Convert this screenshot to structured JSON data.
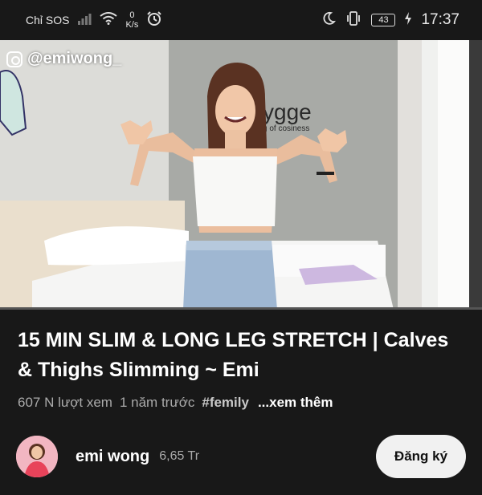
{
  "status_bar": {
    "carrier": "Chỉ SOS",
    "net_speed_value": "0",
    "net_speed_unit": "K/s",
    "battery": "43",
    "time": "17:37"
  },
  "video": {
    "watermark": "@emiwong_",
    "wall_sign": "ygge",
    "wall_sign_sub": "g of cosiness",
    "progress_percent": 0
  },
  "info": {
    "title": "15 MIN SLIM & LONG LEG STRETCH | Calves & Thighs Slimming ~ Emi",
    "views": "607 N lượt xem",
    "age": "1 năm trước",
    "hashtag": "#femily",
    "more": "...xem thêm"
  },
  "channel": {
    "name": "emi wong",
    "subscribers": "6,65 Tr",
    "subscribe_label": "Đăng ký"
  },
  "colors": {
    "background": "#181818",
    "subscribe_bg": "#f1f1f1",
    "progress": "#dd0000"
  }
}
